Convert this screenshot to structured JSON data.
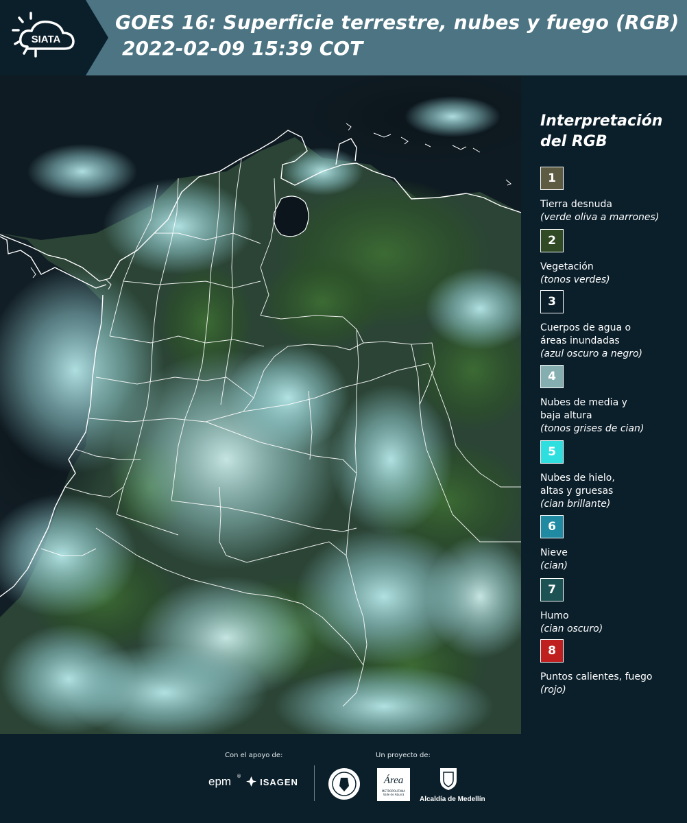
{
  "header": {
    "logo_text": "SIATA",
    "title_line1": "GOES 16: Superficie terrestre, nubes y fuego (RGB)",
    "title_line2": "2022-02-09 15:39 COT"
  },
  "map": {
    "icon": "satellite-rgb-map"
  },
  "legend": {
    "title": "Interpretación del RGB",
    "items": [
      {
        "number": "1",
        "label": "Tierra desnuda",
        "note": "(verde oliva a marrones)",
        "color": "#5d5b42"
      },
      {
        "number": "2",
        "label": "Vegetación",
        "note": "(tonos verdes)",
        "color": "#2f4a25"
      },
      {
        "number": "3",
        "label": "Cuerpos de agua o\náreas inundadas",
        "note": "(azul oscuro a negro)",
        "color": "#0b1f2b"
      },
      {
        "number": "4",
        "label": "Nubes de media y\nbaja altura",
        "note": "(tonos grises de cian)",
        "color": "#85aeb0"
      },
      {
        "number": "5",
        "label": "Nubes de hielo,\naltas y gruesas",
        "note": "(cian brillante)",
        "color": "#2fdfe0"
      },
      {
        "number": "6",
        "label": "Nieve",
        "note": "(cian)",
        "color": "#1f8aa1"
      },
      {
        "number": "7",
        "label": "Humo",
        "note": "(cian oscuro)",
        "color": "#1c5254"
      },
      {
        "number": "8",
        "label": "Puntos calientes, fuego",
        "note": "(rojo)",
        "color": "#c01f1f"
      }
    ]
  },
  "footer": {
    "support_caption": "Con el apoyo de:",
    "project_caption": "Un proyecto de:",
    "epm_logo": "epm",
    "isagen_logo": "ISAGEN",
    "area_logo": "Área",
    "area_sub1": "METROPOLITANA",
    "area_sub2": "Valle de Aburrá",
    "medellin_logo": "Alcaldía de Medellín"
  }
}
